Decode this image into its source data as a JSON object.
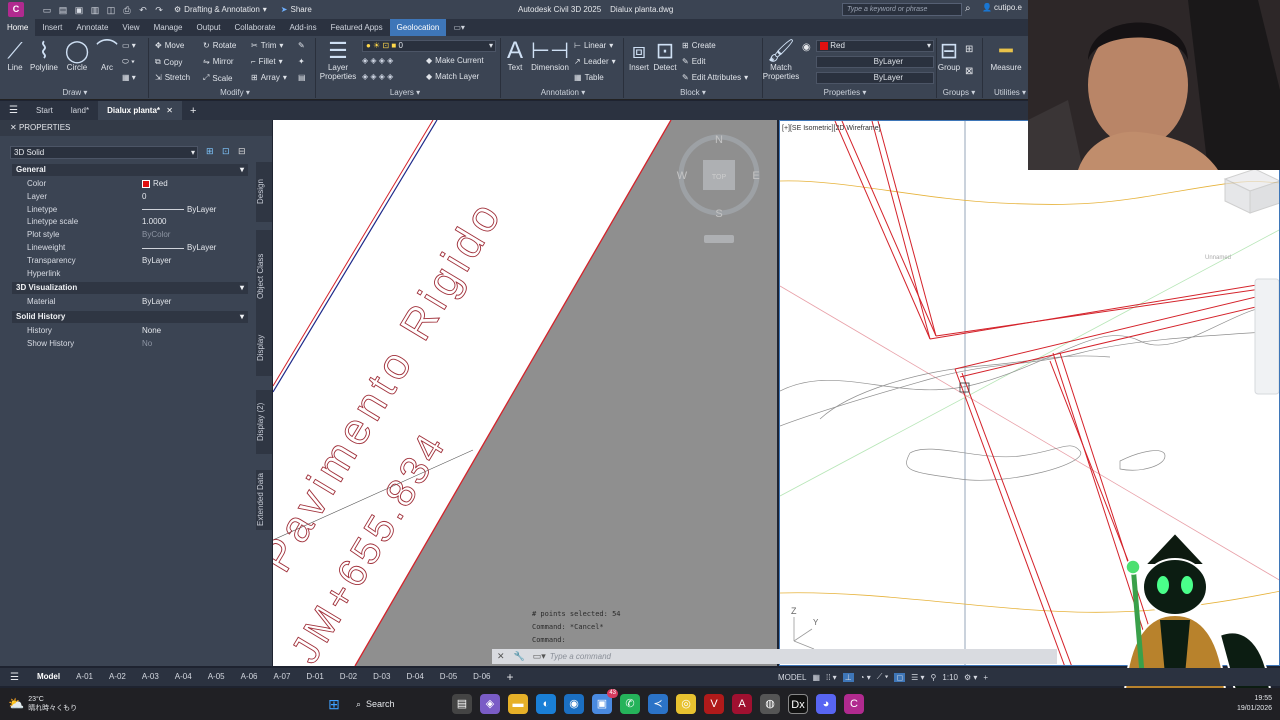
{
  "titlebar": {
    "app_letter": "C",
    "workspace": "Drafting & Annotation",
    "share": "Share",
    "app_title": "Autodesk Civil 3D 2025",
    "file_title": "Dialux planta.dwg",
    "search_placeholder": "Type a keyword or phrase",
    "user": "cutipo.e"
  },
  "ribbon_tabs": [
    "Home",
    "Insert",
    "Annotate",
    "View",
    "Manage",
    "Output",
    "Collaborate",
    "Add-ins",
    "Featured Apps",
    "Geolocation"
  ],
  "ribbon": {
    "draw": {
      "line": "Line",
      "polyline": "Polyline",
      "circle": "Circle",
      "arc": "Arc",
      "panel": "Draw"
    },
    "modify": {
      "move": "Move",
      "rotate": "Rotate",
      "trim": "Trim",
      "copy": "Copy",
      "mirror": "Mirror",
      "fillet": "Fillet",
      "stretch": "Stretch",
      "scale": "Scale",
      "array": "Array",
      "panel": "Modify"
    },
    "layers": {
      "layer_properties": "Layer Properties",
      "current_layer": "0",
      "make_current": "Make Current",
      "match_layer": "Match Layer",
      "panel": "Layers"
    },
    "annotation": {
      "text": "Text",
      "dimension": "Dimension",
      "linear": "Linear",
      "leader": "Leader",
      "table": "Table",
      "panel": "Annotation"
    },
    "block": {
      "insert": "Insert",
      "detect": "Detect",
      "create": "Create",
      "edit": "Edit",
      "edit_attributes": "Edit Attributes",
      "panel": "Block"
    },
    "properties": {
      "match_properties": "Match Properties",
      "color": "Red",
      "linetype": "ByLayer",
      "lineweight": "ByLayer",
      "panel": "Properties"
    },
    "groups": {
      "group": "Group",
      "panel": "Groups"
    },
    "utilities": {
      "measure": "Measure",
      "panel": "Utilities"
    }
  },
  "doc_tabs": [
    "Start",
    "land*",
    "Dialux planta*"
  ],
  "properties": {
    "title": "PROPERTIES",
    "selection": "3D Solid",
    "sections": {
      "general": "General",
      "viz": "3D Visualization",
      "history": "Solid History"
    },
    "general": [
      {
        "k": "Color",
        "v": "Red"
      },
      {
        "k": "Layer",
        "v": "0"
      },
      {
        "k": "Linetype",
        "v": "ByLayer"
      },
      {
        "k": "Linetype scale",
        "v": "1.0000"
      },
      {
        "k": "Plot style",
        "v": "ByColor"
      },
      {
        "k": "Lineweight",
        "v": "ByLayer"
      },
      {
        "k": "Transparency",
        "v": "ByLayer"
      },
      {
        "k": "Hyperlink",
        "v": ""
      }
    ],
    "viz": [
      {
        "k": "Material",
        "v": "ByLayer"
      }
    ],
    "history": [
      {
        "k": "History",
        "v": "None"
      },
      {
        "k": "Show History",
        "v": "No"
      }
    ],
    "side_tabs": [
      "Design",
      "Object Class",
      "Display",
      "Display (2)",
      "Extended Data"
    ]
  },
  "left_view": {
    "label_main": "Pavimento Rigido",
    "label_station": "JM+655.834",
    "viewcube": {
      "n": "N",
      "s": "S",
      "e": "E",
      "w": "W",
      "top": "TOP"
    }
  },
  "right_view": {
    "label": "[+][SE Isometric][2D Wireframe]",
    "unnamed": "Unnamed"
  },
  "command": {
    "lines": [
      "# points selected: 54",
      "Command: *Cancel*",
      "Command:"
    ],
    "placeholder": "Type a command"
  },
  "layout_tabs": [
    "Model",
    "A-01",
    "A-02",
    "A-03",
    "A-04",
    "A-05",
    "A-06",
    "A-07",
    "D-01",
    "D-02",
    "D-03",
    "D-04",
    "D-05",
    "D-06"
  ],
  "status": {
    "model": "MODEL",
    "scale": "1:10"
  },
  "taskbar": {
    "weather_temp": "23°C",
    "weather_text": "晴れ時々くもり",
    "search": "Search",
    "time": "19:55",
    "date": "19/01/2026",
    "badge": "43"
  }
}
